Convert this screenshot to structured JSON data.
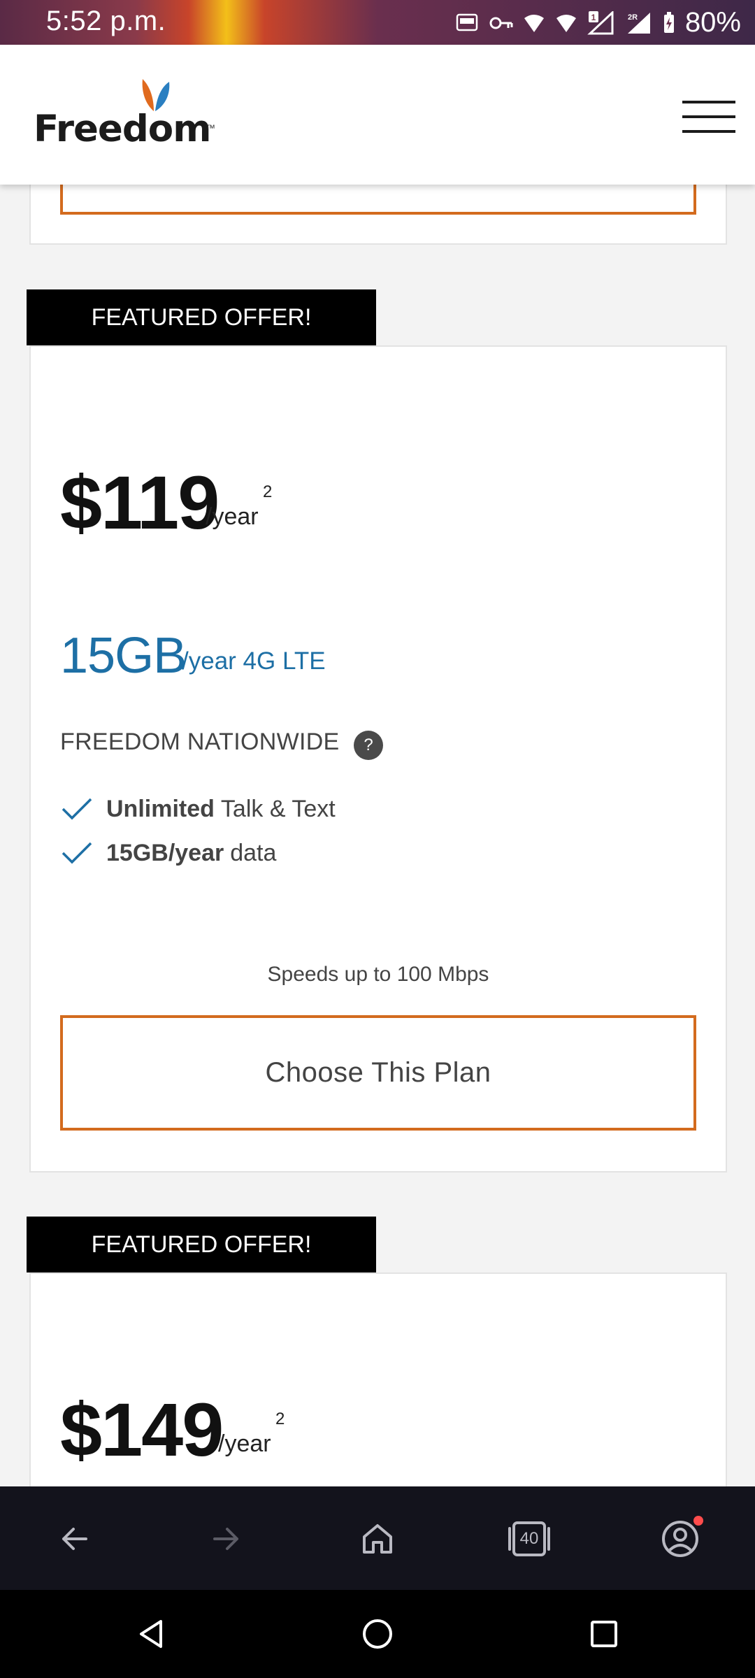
{
  "status_bar": {
    "time": "5:52 p.m.",
    "battery": "80%",
    "icons": [
      "auto-hz-icon",
      "vpn-key-icon",
      "wifi-icon",
      "wifi-icon",
      "signal-sim1-icon",
      "signal-sim2-icon",
      "battery-charging-icon"
    ]
  },
  "header": {
    "logo_text": "Freedom",
    "logo_tm": "™",
    "menu_icon": "hamburger-menu-icon"
  },
  "offers": [
    {
      "badge": "FEATURED OFFER!",
      "price": "$119",
      "per": "/year",
      "footnote": "2",
      "data_amount": "15GB",
      "data_sub": "/year 4G LTE",
      "plan_name": "FREEDOM NATIONWIDE",
      "help": "?",
      "features": [
        {
          "bold": "Unlimited",
          "text": "Talk & Text"
        },
        {
          "bold": "15GB/year",
          "text": "data"
        }
      ],
      "speed": "Speeds up to 100 Mbps",
      "cta": "Choose This Plan"
    },
    {
      "badge": "FEATURED OFFER!",
      "price": "$149",
      "per": "/year",
      "footnote": "2"
    }
  ],
  "browser_bar": {
    "tab_count": "40",
    "icons": [
      "back-arrow-icon",
      "forward-arrow-icon",
      "home-icon",
      "tabs-icon",
      "profile-icon"
    ]
  },
  "colors": {
    "accent_orange": "#d36b1e",
    "data_blue": "#1d6fa5",
    "badge_black": "#000000"
  }
}
